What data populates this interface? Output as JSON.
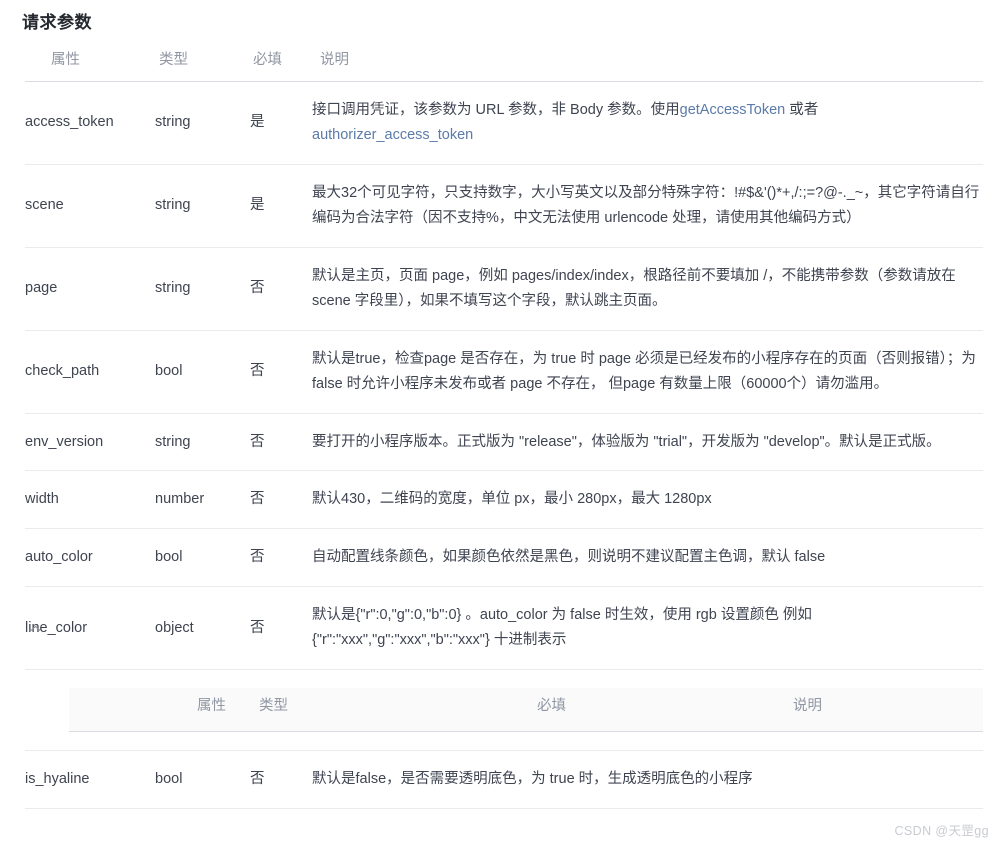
{
  "section": {
    "title": "请求参数"
  },
  "table": {
    "headers": {
      "attribute": "属性",
      "type": "类型",
      "required": "必填",
      "description": "说明"
    },
    "rows": [
      {
        "attribute": "access_token",
        "type": "string",
        "required": "是",
        "description_prefix": "接口调用凭证，该参数为 URL 参数，非 Body 参数。使用",
        "link1": "getAccessToken",
        "description_mid": " 或者 ",
        "link2": "authorizer_access_token",
        "description_suffix": "",
        "has_links": true
      },
      {
        "attribute": "scene",
        "type": "string",
        "required": "是",
        "description": "最大32个可见字符，只支持数字，大小写英文以及部分特殊字符：!#$&'()*+,/:;=?@-._~，其它字符请自行编码为合法字符（因不支持%，中文无法使用 urlencode 处理，请使用其他编码方式）",
        "has_links": false
      },
      {
        "attribute": "page",
        "type": "string",
        "required": "否",
        "description": "默认是主页，页面 page，例如 pages/index/index，根路径前不要填加 /，不能携带参数（参数请放在 scene 字段里），如果不填写这个字段，默认跳主页面。",
        "has_links": false
      },
      {
        "attribute": "check_path",
        "type": "bool",
        "required": "否",
        "description": "默认是true，检查page 是否存在，为 true 时 page 必须是已经发布的小程序存在的页面（否则报错）；为 false 时允许小程序未发布或者 page 不存在， 但page 有数量上限（60000个）请勿滥用。",
        "has_links": false
      },
      {
        "attribute": "env_version",
        "type": "string",
        "required": "否",
        "description": "要打开的小程序版本。正式版为 \"release\"，体验版为 \"trial\"，开发版为 \"develop\"。默认是正式版。",
        "has_links": false
      },
      {
        "attribute": "width",
        "type": "number",
        "required": "否",
        "description": "默认430，二维码的宽度，单位 px，最小 280px，最大 1280px",
        "has_links": false
      },
      {
        "attribute": "auto_color",
        "type": "bool",
        "required": "否",
        "description": "自动配置线条颜色，如果颜色依然是黑色，则说明不建议配置主色调，默认 false",
        "has_links": false
      },
      {
        "attribute": "line_color",
        "type": "object",
        "required": "否",
        "description": "默认是{\"r\":0,\"g\":0,\"b\":0} 。auto_color 为 false 时生效，使用 rgb 设置颜色 例如 {\"r\":\"xxx\",\"g\":\"xxx\",\"b\":\"xxx\"} 十进制表示",
        "has_links": false,
        "expandable": true,
        "expanded": true,
        "toggle_icon": "chevron-up-icon"
      },
      {
        "attribute": "is_hyaline",
        "type": "bool",
        "required": "否",
        "description": "默认是false，是否需要透明底色，为 true 时，生成透明底色的小程序",
        "has_links": false
      }
    ],
    "sub_table": {
      "headers": {
        "attribute": "属性",
        "type": "类型",
        "required": "必填",
        "description": "说明"
      },
      "rows": []
    }
  },
  "watermark": {
    "text": "CSDN @天罡gg"
  },
  "colors": {
    "link": "#5b7ba9",
    "header_text": "#9097a3",
    "body_text": "#3f4451",
    "title": "#24292f",
    "border": "#e9ecef",
    "sub_table_bg": "#fafafa",
    "watermark": "#c8cbd0"
  }
}
